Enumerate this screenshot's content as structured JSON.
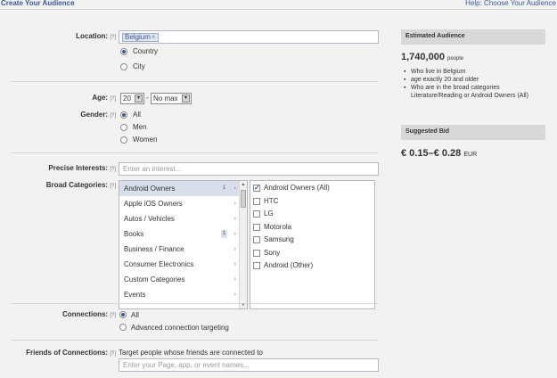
{
  "header": {
    "title": "Create Your Audience",
    "help": "Help: Choose Your Audience"
  },
  "location": {
    "label": "Location:",
    "help": "[?]",
    "token": "Belgium",
    "token_remove": "×",
    "options": [
      "Country",
      "City"
    ],
    "selected": "Country"
  },
  "age": {
    "label": "Age:",
    "help": "[?]",
    "min": "20",
    "dash": "-",
    "max": "No max",
    "arrow": "▼"
  },
  "gender": {
    "label": "Gender:",
    "help": "[?]",
    "options": [
      "All",
      "Men",
      "Women"
    ],
    "selected": "All"
  },
  "precise_interests": {
    "label": "Precise Interests:",
    "help": "[?]",
    "placeholder": "Enter an interest..."
  },
  "broad_categories": {
    "label": "Broad Categories:",
    "help": "[?]",
    "chevron": "›",
    "items": [
      {
        "name": "Android Owners",
        "count": "1",
        "selected": true
      },
      {
        "name": "Apple iOS Owners",
        "count": "",
        "selected": false
      },
      {
        "name": "Autos / Vehicles",
        "count": "",
        "selected": false
      },
      {
        "name": "Books",
        "count": "1",
        "selected": false
      },
      {
        "name": "Business / Finance",
        "count": "",
        "selected": false
      },
      {
        "name": "Consumer Electronics",
        "count": "",
        "selected": false
      },
      {
        "name": "Custom Categories",
        "count": "",
        "selected": false
      },
      {
        "name": "Events",
        "count": "",
        "selected": false
      }
    ],
    "scroll_up": "▲",
    "scroll_down": "▼",
    "subcategories": [
      {
        "name": "Android Owners (All)",
        "checked": true
      },
      {
        "name": "HTC",
        "checked": false
      },
      {
        "name": "LG",
        "checked": false
      },
      {
        "name": "Motorola",
        "checked": false
      },
      {
        "name": "Samsung",
        "checked": false
      },
      {
        "name": "Sony",
        "checked": false
      },
      {
        "name": "Android (Other)",
        "checked": false
      }
    ]
  },
  "connections": {
    "label": "Connections:",
    "help": "[?]",
    "options": [
      "All",
      "Advanced connection targeting"
    ],
    "selected": "All"
  },
  "friends_of_connections": {
    "label": "Friends of Connections:",
    "help": "[?]",
    "text": "Target people whose friends are connected to",
    "placeholder": "Enter your Page, app, or event names..."
  },
  "estimated_audience": {
    "title": "Estimated Audience",
    "count": "1,740,000",
    "unit": "people",
    "bullets": [
      "Who live in Belgium",
      "age exactly 20 and older",
      "Who are in the broad categories Literature/Reading or Android Owners (All)"
    ]
  },
  "suggested_bid": {
    "title": "Suggested Bid",
    "range": "€ 0.15–€ 0.28",
    "currency": "EUR"
  },
  "colors": {
    "brand": "#3b5998",
    "background": "#f2f2f2",
    "panel_header": "#d8d8d8",
    "selected_row": "#d8dfea"
  }
}
